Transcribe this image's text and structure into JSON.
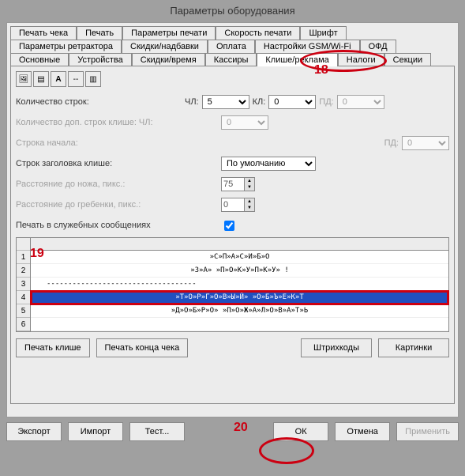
{
  "title": "Параметры оборудования",
  "tabs": {
    "row1": [
      "Печать чека",
      "Печать",
      "Параметры печати",
      "Скорость печати",
      "Шрифт"
    ],
    "row2": [
      "Параметры ретрактора",
      "Скидки/надбавки",
      "Оплата",
      "Настройки GSM/Wi-Fi",
      "ОФД"
    ],
    "row3": [
      "Основные",
      "Устройства",
      "Скидки/время",
      "Кассиры",
      "Клише/реклама",
      "Налоги",
      "Секции"
    ]
  },
  "form": {
    "lines_count": "Количество строк:",
    "chl": "ЧЛ:",
    "chl_val": "5",
    "kl": "КЛ:",
    "kl_val": "0",
    "pd": "ПД:",
    "pd_val": "0",
    "extra_lines": "Количество доп. строк клише: ЧЛ:",
    "extra_val": "0",
    "start_line": "Строка начала:",
    "start_pd": "ПД:",
    "start_pd_val": "0",
    "header_lines": "Строк заголовка клише:",
    "header_val": "По умолчанию",
    "knife_dist": "Расстояние до ножа, пикс.:",
    "knife_val": "75",
    "comb_dist": "Расстояние до гребенки, пикс.:",
    "comb_val": "0",
    "service_print": "Печать в служебных сообщениях"
  },
  "grid_rows": [
    "»С»П»А»С»И»Б»О",
    "»З»А» »П»О»К»У»П»К»У» !",
    "-----------------------------------",
    "»Т»О»Р»Г»О»В»Ы»Й» »О»Б»Ъ»Е»К»Т",
    "»Д»О»Б»Р»О» »П»О»Ж»А»Л»О»В»А»Т»Ь"
  ],
  "buttons": {
    "print_kl": "Печать клише",
    "print_end": "Печать конца чека",
    "barcodes": "Штрихкоды",
    "pictures": "Картинки",
    "export": "Экспорт",
    "import": "Импорт",
    "test": "Тест...",
    "ok": "ОК",
    "cancel": "Отмена",
    "apply": "Применить"
  },
  "annotations": {
    "a18": "18",
    "a19": "19",
    "a20": "20"
  }
}
